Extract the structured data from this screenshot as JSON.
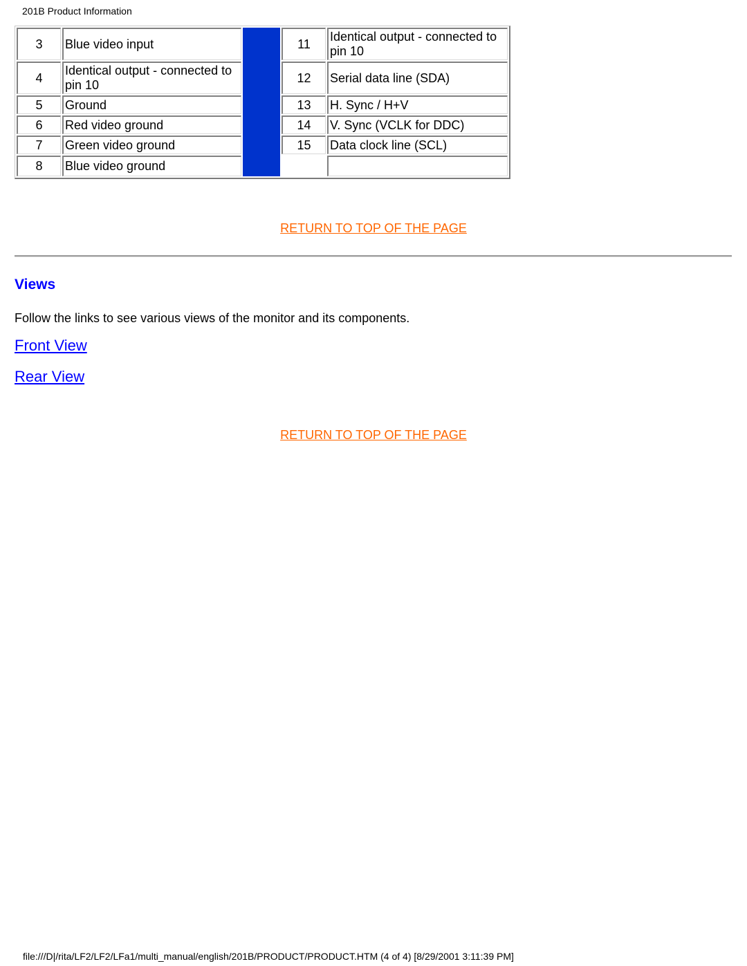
{
  "header": {
    "title": "201B Product Information"
  },
  "pin_table": {
    "left": [
      {
        "pin": "3",
        "desc": "Blue video input"
      },
      {
        "pin": "4",
        "desc": "Identical output - connected to pin 10"
      },
      {
        "pin": "5",
        "desc": "Ground"
      },
      {
        "pin": "6",
        "desc": "Red video ground"
      },
      {
        "pin": "7",
        "desc": "Green video ground"
      },
      {
        "pin": "8",
        "desc": "Blue video ground"
      }
    ],
    "right": [
      {
        "pin": "11",
        "desc": "Identical output - connected to pin 10"
      },
      {
        "pin": "12",
        "desc": "Serial data line (SDA)"
      },
      {
        "pin": "13",
        "desc": "H. Sync / H+V"
      },
      {
        "pin": "14",
        "desc": "V. Sync (VCLK for DDC)"
      },
      {
        "pin": "15",
        "desc": "Data clock line (SCL)"
      },
      {
        "pin": "",
        "desc": ""
      }
    ],
    "divider_color": "#0033cc"
  },
  "links": {
    "return_top": "RETURN TO TOP OF THE PAGE",
    "return_color": "#ff6600"
  },
  "views": {
    "title": "Views",
    "intro": "Follow the links to see various views of the monitor and its components.",
    "front": "Front View",
    "rear": "Rear View"
  },
  "footer": {
    "path": "file:///D|/rita/LF2/LF2/LFa1/multi_manual/english/201B/PRODUCT/PRODUCT.HTM (4 of 4) [8/29/2001 3:11:39 PM]"
  }
}
